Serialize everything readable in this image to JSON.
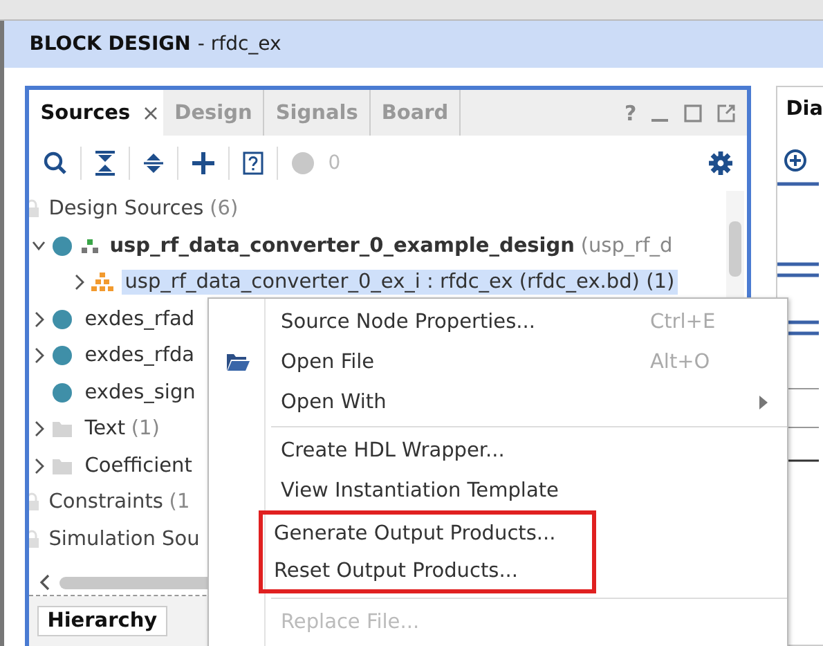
{
  "banner": {
    "title": "BLOCK DESIGN",
    "subtitle": "- rfdc_ex"
  },
  "sources_panel": {
    "tabs": [
      {
        "label": "Sources",
        "selected": true,
        "closable": true
      },
      {
        "label": "Design",
        "selected": false,
        "closable": false
      },
      {
        "label": "Signals",
        "selected": false,
        "closable": false
      },
      {
        "label": "Board",
        "selected": false,
        "closable": false
      }
    ],
    "help": "?",
    "message_count": "0",
    "tree": [
      {
        "kind": "category",
        "label": "Design Sources",
        "count": "(6)",
        "children": [
          {
            "kind": "ip",
            "label": "usp_rf_data_converter_0_example_design",
            "count": "(usp_rf_d",
            "bold": true,
            "expanded": true,
            "selected": false,
            "children": [
              {
                "kind": "bd",
                "label": "usp_rf_data_converter_0_ex_i : rfdc_ex (rfdc_ex.bd) (1)",
                "expanded": false,
                "selected": true
              }
            ]
          },
          {
            "kind": "ip",
            "label": "exdes_rfad",
            "expanded": false,
            "selected": false
          },
          {
            "kind": "ip",
            "label": "exdes_rfda",
            "expanded": false,
            "selected": false
          },
          {
            "kind": "ip",
            "label": "exdes_sign",
            "selected": false
          },
          {
            "kind": "folder",
            "label": "Text",
            "count": "(1)",
            "expanded": false,
            "selected": false
          },
          {
            "kind": "folder",
            "label": "Coefficient",
            "expanded": false,
            "selected": false
          }
        ]
      },
      {
        "kind": "category",
        "label": "Constraints",
        "count": "(1"
      },
      {
        "kind": "category",
        "label": "Simulation Sou"
      }
    ],
    "bottom_tabs": [
      {
        "label": "Hierarchy",
        "selected": true
      }
    ]
  },
  "diagram_panel": {
    "tab": "Dia"
  },
  "context_menu": {
    "items": [
      {
        "kind": "item",
        "label": "Source Node Properties...",
        "shortcut": "Ctrl+E",
        "disabled": false,
        "highlighted": false
      },
      {
        "kind": "folder",
        "label": "Open File",
        "shortcut": "Alt+O",
        "disabled": false,
        "highlighted": false
      },
      {
        "kind": "item",
        "label": "Open With",
        "submenu": true,
        "disabled": false,
        "highlighted": false
      },
      {
        "kind": "separator"
      },
      {
        "kind": "item",
        "label": "Create HDL Wrapper...",
        "disabled": false,
        "highlighted": false
      },
      {
        "kind": "item",
        "label": "View Instantiation Template",
        "disabled": false,
        "highlighted": false
      },
      {
        "kind": "item",
        "label": "Generate Output Products...",
        "disabled": false,
        "highlighted": true
      },
      {
        "kind": "item",
        "label": "Reset Output Products...",
        "disabled": false,
        "highlighted": true
      },
      {
        "kind": "separator"
      },
      {
        "kind": "item",
        "label": "Replace File...",
        "disabled": true,
        "highlighted": false
      }
    ]
  }
}
